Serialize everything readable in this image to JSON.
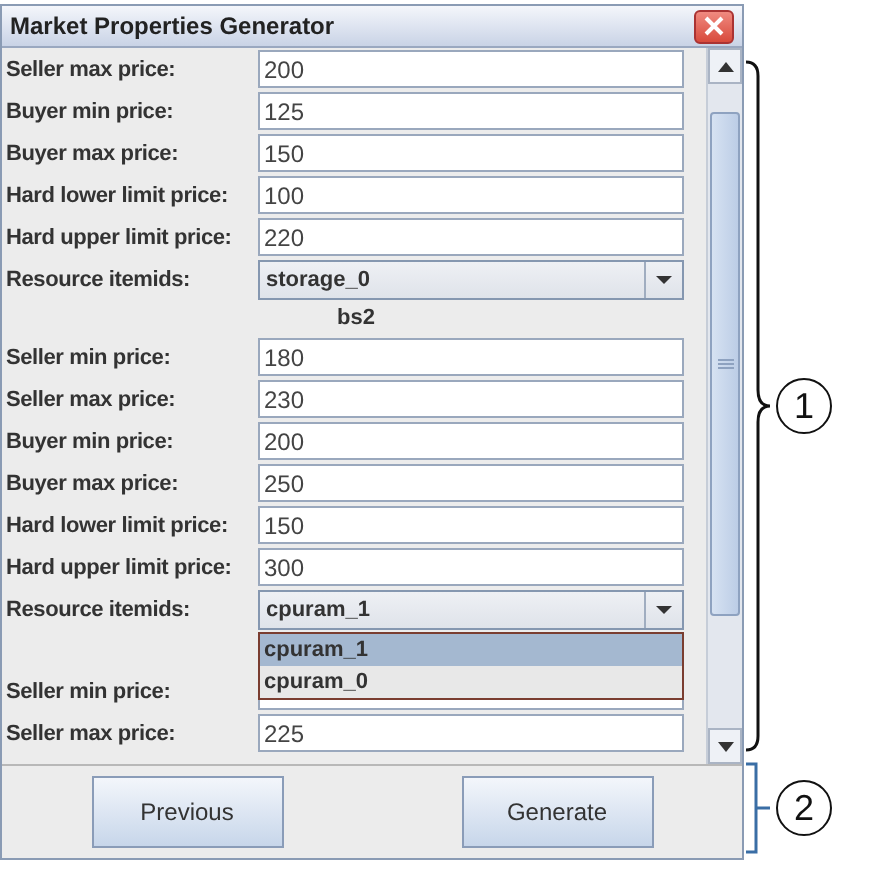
{
  "window": {
    "title": "Market Properties Generator"
  },
  "sections": [
    {
      "fields": [
        {
          "kind": "text",
          "label": "Seller max price:",
          "value": "200"
        },
        {
          "kind": "text",
          "label": "Buyer min price:",
          "value": "125"
        },
        {
          "kind": "text",
          "label": "Buyer max price:",
          "value": "150"
        },
        {
          "kind": "text",
          "label": "Hard lower limit price:",
          "value": "100"
        },
        {
          "kind": "text",
          "label": "Hard upper limit price:",
          "value": "220"
        },
        {
          "kind": "combo",
          "label": "Resource itemids:",
          "value": "storage_0"
        }
      ]
    },
    {
      "heading": "bs2",
      "fields": [
        {
          "kind": "text",
          "label": "Seller min price:",
          "value": "180"
        },
        {
          "kind": "text",
          "label": "Seller max price:",
          "value": "230"
        },
        {
          "kind": "text",
          "label": "Buyer min price:",
          "value": "200"
        },
        {
          "kind": "text",
          "label": "Buyer max price:",
          "value": "250"
        },
        {
          "kind": "text",
          "label": "Hard lower limit price:",
          "value": "150"
        },
        {
          "kind": "text",
          "label": "Hard upper limit price:",
          "value": "300"
        },
        {
          "kind": "combo",
          "label": "Resource itemids:",
          "value": "cpuram_1",
          "options": [
            {
              "label": "cpuram_1",
              "selected": true
            },
            {
              "label": "cpuram_0",
              "selected": false
            }
          ]
        }
      ]
    },
    {
      "fields": [
        {
          "kind": "text",
          "label": "Seller min price:"
        },
        {
          "kind": "text",
          "label": "Seller max price:",
          "value": "225"
        }
      ]
    }
  ],
  "buttons": [
    "Previous",
    "Generate"
  ],
  "callouts": [
    "1",
    "2"
  ]
}
